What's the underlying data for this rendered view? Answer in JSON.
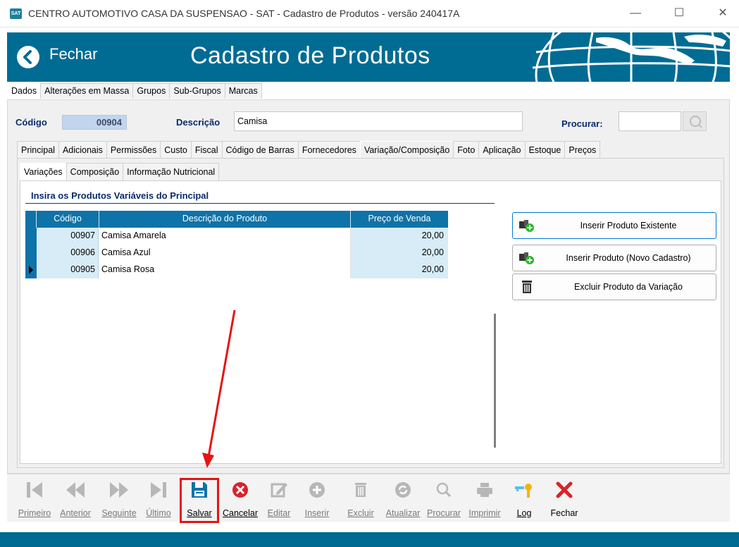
{
  "window": {
    "title": "CENTRO AUTOMOTIVO CASA DA SUSPENSAO  - SAT - Cadastro de Produtos - versão 240417A",
    "app_icon_text": "SAT"
  },
  "header": {
    "close_label": "Fechar",
    "page_title": "Cadastro de Produtos",
    "color": "#006c93"
  },
  "top_tabs": [
    "Dados",
    "Alterações em Massa",
    "Grupos",
    "Sub-Grupos",
    "Marcas"
  ],
  "fields": {
    "code_label": "Código",
    "code_value": "00904",
    "desc_label": "Descrição",
    "desc_value": "Camisa",
    "search_label": "Procurar:",
    "search_value": ""
  },
  "main_tabs": [
    "Principal",
    "Adicionais",
    "Permissões",
    "Custo",
    "Fiscal",
    "Código de Barras",
    "Fornecedores",
    "Variação/Composição",
    "Foto",
    "Aplicação",
    "Estoque",
    "Preços"
  ],
  "sub_tabs": [
    "Variações",
    "Composição",
    "Informação Nutricional"
  ],
  "section_title": "Insira os Produtos Variáveis do Principal",
  "grid": {
    "headers": [
      "Código",
      "Descrição do Produto",
      "Preço de Venda"
    ],
    "rows": [
      {
        "code": "00907",
        "desc": "Camisa Amarela",
        "price": "20,00"
      },
      {
        "code": "00906",
        "desc": "Camisa Azul",
        "price": "20,00"
      },
      {
        "code": "00905",
        "desc": "Camisa Rosa",
        "price": "20,00"
      }
    ]
  },
  "actions": {
    "insert_existing": "Inserir Produto Existente",
    "insert_new": "Inserir Produto (Novo Cadastro)",
    "remove": "Excluir Produto da Variação"
  },
  "toolbar": {
    "first": "Primeiro",
    "previous": "Anterior",
    "next": "Seguinte",
    "last": "Último",
    "save": "Salvar",
    "cancel": "Cancelar",
    "edit": "Editar",
    "insert": "Inserir",
    "delete": "Excluir",
    "refresh": "Atualizar",
    "search": "Procurar",
    "print": "Imprimir",
    "log": "Log",
    "close": "Fechar"
  },
  "colors": {
    "accent": "#0e73a8",
    "highlight": "#e81313",
    "statusbar": "#016a92"
  }
}
